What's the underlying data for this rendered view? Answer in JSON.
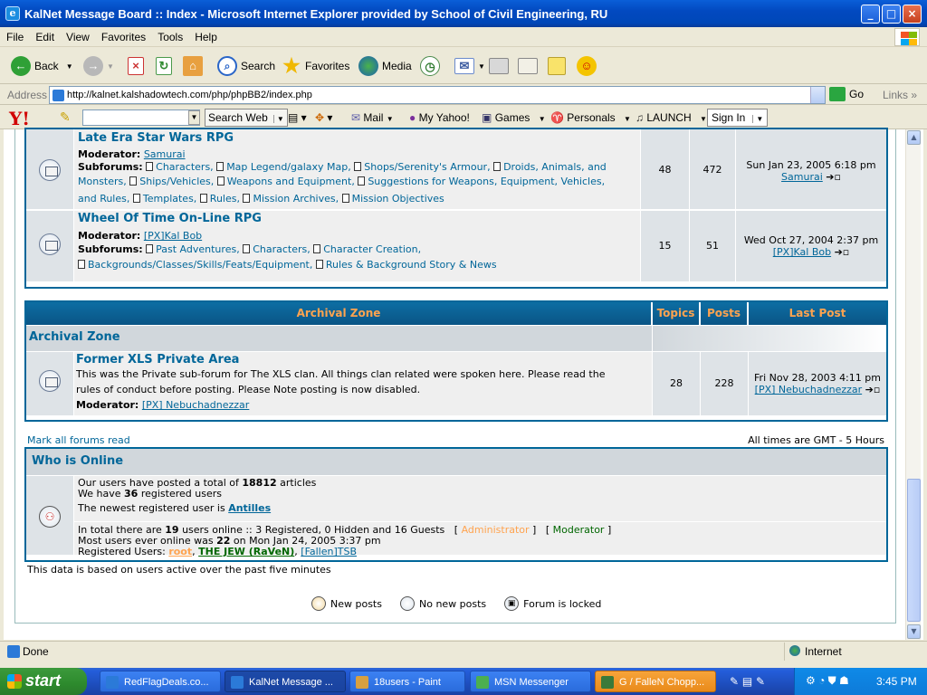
{
  "window": {
    "title": "KalNet Message Board :: Index - Microsoft Internet Explorer provided by School of Civil Engineering, RU"
  },
  "menu": [
    "File",
    "Edit",
    "View",
    "Favorites",
    "Tools",
    "Help"
  ],
  "toolbar": {
    "back": "Back",
    "search": "Search",
    "favorites": "Favorites",
    "media": "Media"
  },
  "address": {
    "label": "Address",
    "url": "http://kalnet.kalshadowtech.com/php/phpBB2/index.php",
    "go": "Go",
    "links": "Links"
  },
  "yahoo": {
    "logo": "Y!",
    "search_button": "Search Web",
    "mail": "Mail",
    "my_yahoo": "My Yahoo!",
    "games": "Games",
    "personals": "Personals",
    "launch": "LAUNCH",
    "sign_in": "Sign In"
  },
  "forums": [
    {
      "name": "Late Era Star Wars RPG",
      "moderator_label": "Moderator:",
      "moderator": "Samurai",
      "subforums_label": "Subforums:",
      "subforum_lines": [
        [
          "Characters,",
          "Map Legend/galaxy Map,",
          "Shops/Serenity's Armour,",
          "Droids, Animals, and"
        ],
        [
          "Monsters,",
          "Ships/Vehicles,",
          "Weapons and Equipment,",
          "Suggestions for Weapons, Equipment, Vehicles,"
        ],
        [
          "and Rules,",
          "Templates,",
          "Rules,",
          "Mission Archives,",
          "Mission Objectives"
        ]
      ],
      "topics": "48",
      "posts": "472",
      "last_post_date": "Sun Jan 23, 2005 6:18 pm",
      "last_post_user": "Samurai"
    },
    {
      "name": "Wheel Of Time On-Line RPG",
      "moderator_label": "Moderator:",
      "moderator": "[PX]Kal Bob",
      "subforums_label": "Subforums:",
      "subforum_lines": [
        [
          "Past Adventures,",
          "Characters,",
          "Character Creation,"
        ],
        [
          "Backgrounds/Classes/Skills/Feats/Equipment,",
          "Rules & Background Story & News"
        ]
      ],
      "topics": "15",
      "posts": "51",
      "last_post_date": "Wed Oct 27, 2004 2:37 pm",
      "last_post_user": "[PX]Kal Bob"
    }
  ],
  "archival": {
    "headers": {
      "forum": "Archival Zone",
      "topics": "Topics",
      "posts": "Posts",
      "last_post": "Last Post"
    },
    "category": "Archival Zone",
    "forum": {
      "name": "Former XLS Private Area",
      "desc_line1": "This was the Private sub-forum for The XLS clan. All things clan related were spoken here. Please read the",
      "desc_line2": "rules of conduct before posting. Please Note posting is now disabled.",
      "moderator_label": "Moderator:",
      "moderator": "[PX] Nebuchadnezzar",
      "topics": "28",
      "posts": "228",
      "last_post_date": "Fri Nov 28, 2003 4:11 pm",
      "last_post_user": "[PX] Nebuchadnezzar"
    }
  },
  "mark_read": "Mark all forums read",
  "timezone": "All times are GMT - 5 Hours",
  "online": {
    "title": "Who is Online",
    "total_pre": "Our users have posted a total of",
    "total_count": "18812",
    "total_post": "articles",
    "reg_pre": "We have",
    "reg_count": "36",
    "reg_post": "registered users",
    "newest_pre": "The newest registered user is",
    "newest_user": "Antilles",
    "intotal_pre": "In total there are",
    "intotal_count": "19",
    "intotal_post": "users online :: 3 Registered, 0 Hidden and 16 Guests",
    "legend_admin": "Administrator",
    "legend_mod": "Moderator",
    "most_pre": "Most users ever online was",
    "most_count": "22",
    "most_post": "on Mon Jan 24, 2005 3:37 pm",
    "reg_users_label": "Registered Users:",
    "users": [
      "root",
      "THE JEW (RaVeN)",
      "[Fallen]TSB"
    ]
  },
  "based_on": "This data is based on users active over the past five minutes",
  "legend": {
    "new_posts": "New posts",
    "no_new_posts": "No new posts",
    "locked": "Forum is locked"
  },
  "status": {
    "text": "Done",
    "zone": "Internet"
  },
  "taskbar": {
    "start": "start",
    "tasks": [
      "RedFlagDeals.co...",
      "KalNet Message ...",
      "18users - Paint",
      "MSN Messenger",
      "G / FalleN Chopp..."
    ],
    "clock": "3:45 PM"
  },
  "colors": {
    "link": "#006699",
    "admin": "#FFA34F",
    "moderator": "#006600",
    "header_bg": "#0A5585"
  }
}
